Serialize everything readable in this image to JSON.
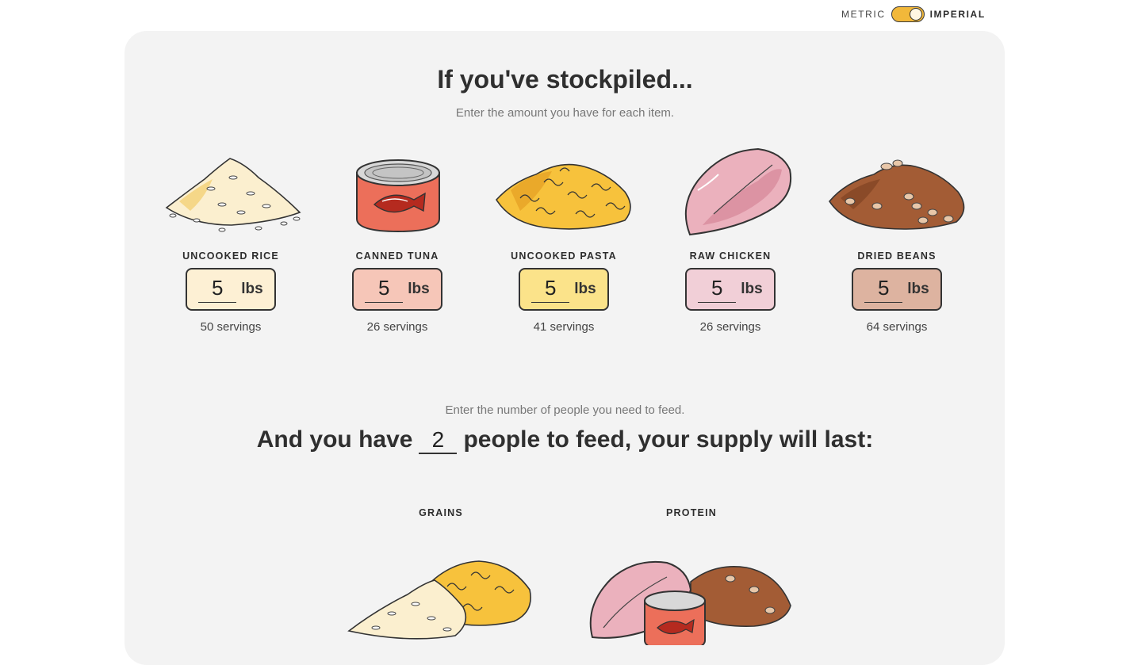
{
  "units": {
    "metric_label": "METRIC",
    "imperial_label": "IMPERIAL",
    "selected": "imperial"
  },
  "header": {
    "title": "If you've stockpiled...",
    "subtitle": "Enter the amount you have for each item."
  },
  "items": [
    {
      "label": "UNCOOKED RICE",
      "value": "5",
      "unit": "lbs",
      "servings": "50 servings",
      "box_color": "#fdf0d4",
      "icon": "rice-icon"
    },
    {
      "label": "CANNED TUNA",
      "value": "5",
      "unit": "lbs",
      "servings": "26 servings",
      "box_color": "#f6c6b8",
      "icon": "tuna-can-icon"
    },
    {
      "label": "UNCOOKED PASTA",
      "value": "5",
      "unit": "lbs",
      "servings": "41 servings",
      "box_color": "#fbe38a",
      "icon": "pasta-icon"
    },
    {
      "label": "RAW CHICKEN",
      "value": "5",
      "unit": "lbs",
      "servings": "26 servings",
      "box_color": "#f1cfd7",
      "icon": "chicken-icon"
    },
    {
      "label": "DRIED BEANS",
      "value": "5",
      "unit": "lbs",
      "servings": "64 servings",
      "box_color": "#ddb3a0",
      "icon": "beans-icon"
    }
  ],
  "people": {
    "hint": "Enter the number of people you need to feed.",
    "prefix": "And you have",
    "value": "2",
    "suffix": "people to feed, your supply will last:"
  },
  "results": [
    {
      "label": "GRAINS",
      "icon": "grains-icon"
    },
    {
      "label": "PROTEIN",
      "icon": "protein-icon"
    }
  ]
}
